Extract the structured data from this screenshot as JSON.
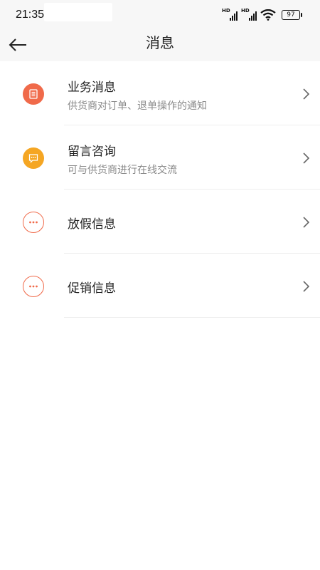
{
  "status_bar": {
    "time": "21:35",
    "network_1": "HD",
    "network_2": "HD",
    "battery": "97"
  },
  "nav": {
    "title": "消息",
    "back_icon": "arrow-left-icon"
  },
  "items": [
    {
      "title": "业务消息",
      "desc": "供货商对订单、退单操作的通知",
      "icon": "document-icon",
      "icon_color": "#f06a4a"
    },
    {
      "title": "留言咨询",
      "desc": "可与供货商进行在线交流",
      "icon": "chat-icon",
      "icon_color": "#f5a623"
    },
    {
      "title": "放假信息",
      "desc": "",
      "icon": "more-dots-icon",
      "icon_color": "#f06a4a"
    },
    {
      "title": "促销信息",
      "desc": "",
      "icon": "more-dots-icon",
      "icon_color": "#f06a4a"
    }
  ]
}
